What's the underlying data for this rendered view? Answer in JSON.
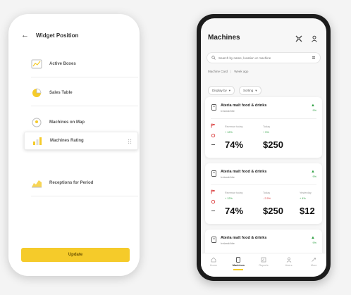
{
  "widget_screen": {
    "title": "Widget Position",
    "items": [
      {
        "label": "Active Boxes"
      },
      {
        "label": "Sales Table"
      },
      {
        "label": "Machines on Map"
      },
      {
        "label": "Machines Rating"
      },
      {
        "label": "Receptions for Period"
      }
    ],
    "update_label": "Update"
  },
  "machines_screen": {
    "title": "Machines",
    "search_placeholder": "Search by name, location or machine",
    "filter_primary": "Machine Card",
    "filter_secondary": "Week ago",
    "chip_display": "Display by",
    "chip_sorting": "Sorting",
    "cards": [
      {
        "name": "Ateria malt food & drinks",
        "sub": "Ireland/bite",
        "top_trend": "9%",
        "col1_label": "Revenue today",
        "col1_trend": "+ 12%",
        "col1_value": "74%",
        "col2_label": "Today",
        "col2_trend": "+ 5%",
        "col2_value": "$250"
      },
      {
        "name": "Ateria malt food & drinks",
        "sub": "Ireland/bite",
        "top_trend": "9%",
        "col1_label": "Revenue today",
        "col1_trend": "+ 12%",
        "col1_value": "74%",
        "col2_label": "Today",
        "col2_trend": "- 2.5%",
        "col2_value": "$250",
        "col3_label": "Yesterday",
        "col3_trend": "+ 4%",
        "col3_value": "$12"
      },
      {
        "name": "Ateria malt food & drinks",
        "sub": "Ireland/bite",
        "top_trend": "9%"
      }
    ],
    "tabs": [
      {
        "label": "Home",
        "icon": "home-icon"
      },
      {
        "label": "Machines",
        "icon": "machine-icon"
      },
      {
        "label": "Reports",
        "icon": "reports-icon"
      },
      {
        "label": "Users",
        "icon": "users-icon"
      },
      {
        "label": "More",
        "icon": "more-icon"
      }
    ],
    "colors": {
      "accent": "#f5cb2a",
      "positive": "#2ea043",
      "negative": "#d93a3a"
    }
  }
}
